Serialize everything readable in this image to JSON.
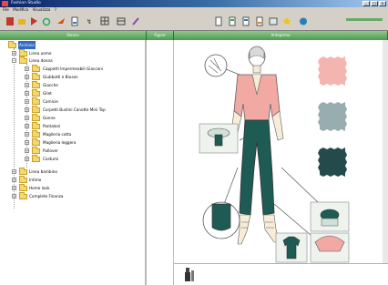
{
  "window": {
    "title": "Fashion Studio",
    "min": "_",
    "max": "□",
    "close": "×"
  },
  "menu": [
    "File",
    "Modifica",
    "Visualizza",
    "?"
  ],
  "toolbar": {
    "icons": [
      "new-icon",
      "open-icon",
      "save-icon",
      "cut-icon",
      "copy-icon",
      "paste-icon",
      "rotate-icon",
      "grid-icon",
      "pen-icon",
      "page-icon",
      "page-icon",
      "page-icon",
      "page-icon",
      "arrow-icon",
      "star-icon",
      "globe-icon"
    ],
    "colors": [
      "#c0392b",
      "#e67e22",
      "#f1c40f",
      "#27ae60",
      "#2980b9"
    ]
  },
  "panes": {
    "left": "Elenco",
    "middle": "Figure",
    "right": "Anteprima"
  },
  "tree": {
    "root": "Archivio",
    "items": [
      {
        "label": "Linea uomo",
        "level": 1
      },
      {
        "label": "Linea donna",
        "level": 1
      },
      {
        "label": "Cappotti Impermeabili Giacconi",
        "level": 2
      },
      {
        "label": "Giubbotti e Bluson",
        "level": 2
      },
      {
        "label": "Giacche",
        "level": 2
      },
      {
        "label": "Gilet",
        "level": 2
      },
      {
        "label": "Camicie",
        "level": 2
      },
      {
        "label": "Corpetti Bustini Canotte Mini Top",
        "level": 2
      },
      {
        "label": "Gonne",
        "level": 2
      },
      {
        "label": "Pantaloni",
        "level": 2
      },
      {
        "label": "Maglieria cotta",
        "level": 2
      },
      {
        "label": "Maglieria leggera",
        "level": 2
      },
      {
        "label": "Pullover",
        "level": 2
      },
      {
        "label": "Costumi",
        "level": 2
      },
      {
        "label": "Linea bambino",
        "level": 1
      },
      {
        "label": "Intimo",
        "level": 1
      },
      {
        "label": "Home look",
        "level": 1
      },
      {
        "label": "Complete Finanza",
        "level": 1
      }
    ]
  },
  "swatches": [
    "#f4b4b0",
    "#97adb0",
    "#244a4b"
  ],
  "colors": {
    "jacket": "#f2a9a4",
    "pants": "#1e5b55",
    "skin": "#f6ecd8",
    "outline": "#606060"
  }
}
